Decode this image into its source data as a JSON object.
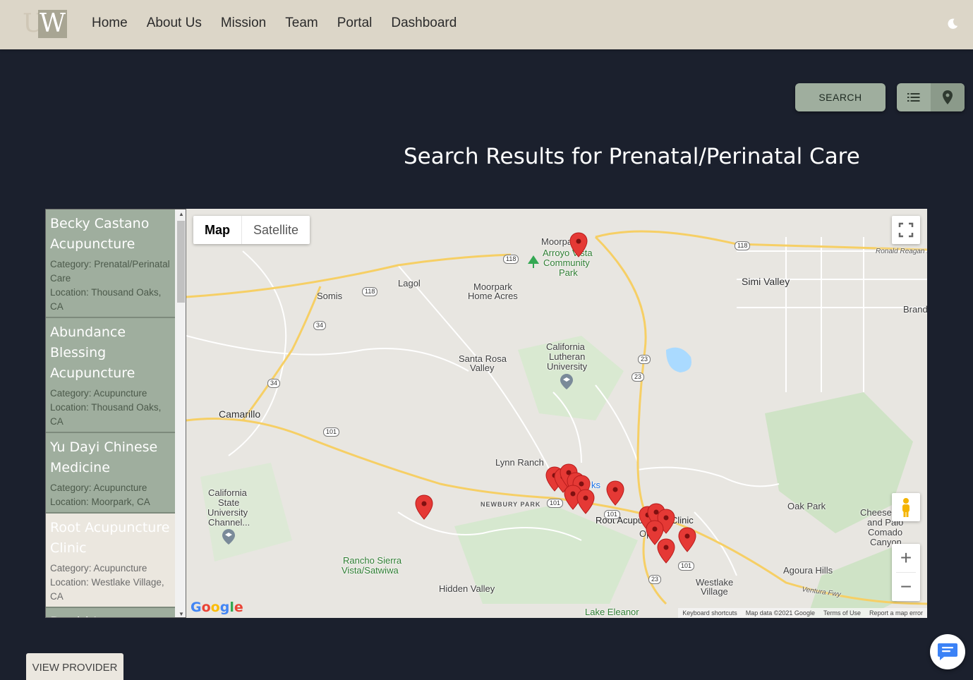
{
  "nav": {
    "logo_u": "U",
    "logo_w": "W",
    "links": [
      "Home",
      "About Us",
      "Mission",
      "Team",
      "Portal",
      "Dashboard"
    ]
  },
  "controls": {
    "search_label": "SEARCH",
    "list_view_icon": "list-icon",
    "map_view_icon": "map-pin-icon"
  },
  "results_title": "Search Results for Prenatal/Perinatal Care",
  "providers": [
    {
      "name": "Becky Castano Acupuncture",
      "category": "Category: Prenatal/Perinatal Care",
      "location": "Location: Thousand Oaks, CA"
    },
    {
      "name": "Abundance Blessing Acupuncture",
      "category": "Category: Acupuncture",
      "location": "Location: Thousand Oaks, CA"
    },
    {
      "name": "Yu Dayi Chinese Medicine",
      "category": "Category: Acupuncture",
      "location": "Location: Moorpark, CA"
    },
    {
      "name": "Root Acupuncture Clinic",
      "category": "Category: Acupuncture",
      "location": "Location: Westlake Village, CA"
    },
    {
      "name": "David Lee",
      "category": "",
      "location": ""
    }
  ],
  "map": {
    "type_map": "Map",
    "type_satellite": "Satellite",
    "labels": {
      "moorpark": "Moorpa",
      "arroyo": "Arroyo Vista",
      "community": "Community",
      "park": "Park",
      "lagol": "Lagol",
      "somis": "Somis",
      "moorpark_acres1": "Moorpark",
      "moorpark_acres2": "Home Acres",
      "simi": "Simi Valley",
      "ronald": "Ronald Reagan F",
      "brand": "Brand",
      "santa_rosa1": "Santa Rosa",
      "santa_rosa2": "Valley",
      "clu1": "California",
      "clu2": "Lutheran",
      "clu3": "University",
      "camarillo": "Camarillo",
      "lynn": "Lynn Ranch",
      "ks": "ks",
      "newbury": "NEWBURY PARK",
      "root_clinic": "Root Acupuncture Clinic",
      "op": "Op",
      "csu1": "California",
      "csu2": "State",
      "csu3": "University",
      "csu4": "Channel...",
      "oak_park": "Oak Park",
      "cheese1": "Cheese",
      "cheese2": "and Paio",
      "cheese3": "Comado",
      "cheese4": "Canyon",
      "rancho1": "Rancho Sierra",
      "rancho2": "Vista/Satwiwa",
      "agoura": "Agoura Hills",
      "ventura": "Ventura Fwy",
      "westlake1": "Westlake",
      "westlake2": "Village",
      "hidden": "Hidden Valley",
      "eleanor": "Lake Eleanor"
    },
    "shields": [
      "118",
      "118",
      "118",
      "34",
      "34",
      "101",
      "23",
      "23",
      "101",
      "101",
      "23",
      "101"
    ],
    "google": "Google",
    "attribution": [
      "Keyboard shortcuts",
      "Map data ©2021 Google",
      "Terms of Use",
      "Report a map error"
    ]
  },
  "view_provider_label": "VIEW PROVIDER",
  "colors": {
    "background": "#1b202d",
    "navbar": "#dcd6c8",
    "accent_green": "#9fae9e",
    "selected_item": "#ebe7df",
    "marker": "#e53935"
  }
}
